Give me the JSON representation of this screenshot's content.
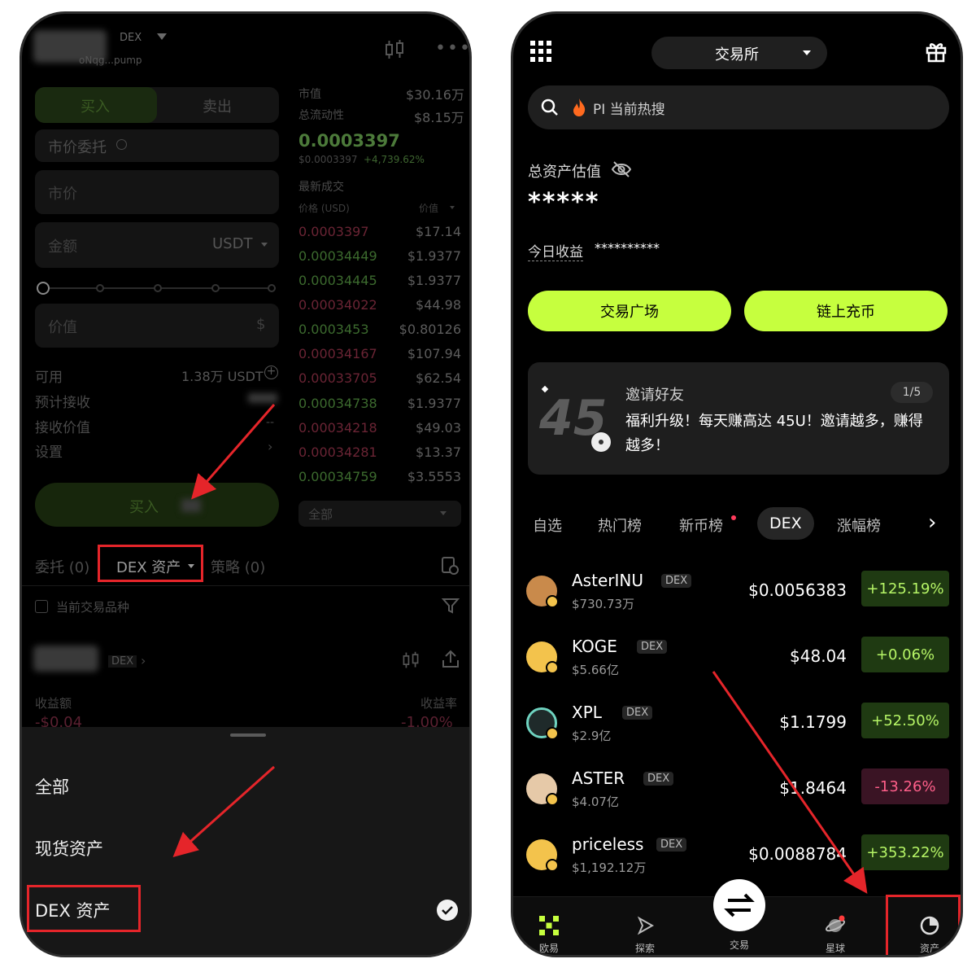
{
  "left": {
    "header": {
      "dex_tag": "DEX",
      "address": "oNqg...pump"
    },
    "trade_tabs": {
      "buy": "买入",
      "sell": "卖出"
    },
    "order_type": "市价委托",
    "market_input": "市价",
    "amount": {
      "label": "金额",
      "unit": "USDT"
    },
    "value_field": {
      "label": "价值",
      "unit": "$"
    },
    "available": {
      "label": "可用",
      "value": "1.38万 USDT"
    },
    "info_rows": [
      "预计接收",
      "接收价值",
      "设置"
    ],
    "receive_value_placeholder": "--",
    "buy_button": "买入",
    "stats": {
      "mcap_label": "市值",
      "mcap": "$30.16万",
      "liq_label": "总流动性",
      "liq": "$8.15万"
    },
    "price": "0.0003397",
    "price_sub": "$0.0003397",
    "price_change": "+4,739.62%",
    "recent_trades": "最新成交",
    "ob_headers": {
      "price": "价格 (USD)",
      "value": "价值"
    },
    "orderbook": [
      {
        "p": "0.0003397",
        "v": "$17.14",
        "side": "sell"
      },
      {
        "p": "0.00034449",
        "v": "$1.9377",
        "side": "buy"
      },
      {
        "p": "0.00034445",
        "v": "$1.9377",
        "side": "buy"
      },
      {
        "p": "0.00034022",
        "v": "$44.98",
        "side": "sell"
      },
      {
        "p": "0.0003453",
        "v": "$0.80126",
        "side": "buy"
      },
      {
        "p": "0.00034167",
        "v": "$107.94",
        "side": "sell"
      },
      {
        "p": "0.00033705",
        "v": "$62.54",
        "side": "sell"
      },
      {
        "p": "0.00034738",
        "v": "$1.9377",
        "side": "buy"
      },
      {
        "p": "0.00034218",
        "v": "$49.03",
        "side": "sell"
      },
      {
        "p": "0.00034281",
        "v": "$13.37",
        "side": "sell"
      },
      {
        "p": "0.00034759",
        "v": "$3.5553",
        "side": "buy"
      }
    ],
    "ob_filter": "全部",
    "bottom_tabs": {
      "orders": "委托 (0)",
      "dex_assets": "DEX 资产",
      "strategy": "策略 (0)"
    },
    "current_pair": "当前交易品种",
    "position": {
      "dex_tag": "DEX",
      "pnl_label": "收益额",
      "pnl_rate_label": "收益率",
      "pnl": "-$0.04",
      "pnl_rate": "-1.00%"
    },
    "sheet": {
      "items": [
        "全部",
        "现货资产",
        "DEX 资产"
      ],
      "selected_index": 2
    }
  },
  "right": {
    "exchange_selector": "交易所",
    "search": {
      "placeholder": "PI 当前热搜"
    },
    "total_assets_label": "总资产估值",
    "total_assets_value": "*****",
    "today_pnl_label": "今日收益",
    "today_pnl_value": "**********",
    "buttons": {
      "trade_square": "交易广场",
      "deposit": "链上充币"
    },
    "banner": {
      "number": "45",
      "title": "邀请好友",
      "page": "1/5",
      "text": "福利升级！每天赚高达 45U！邀请越多，赚得越多！"
    },
    "tabs": [
      "自选",
      "热门榜",
      "新币榜",
      "DEX",
      "涨幅榜"
    ],
    "active_tab_index": 3,
    "coins": [
      {
        "name": "AsterINU",
        "tag": "DEX",
        "cap": "$730.73万",
        "price": "$0.0056383",
        "change": "+125.19%",
        "dir": "up",
        "color": "#c98a4b"
      },
      {
        "name": "KOGE",
        "tag": "DEX",
        "cap": "$5.66亿",
        "price": "$48.04",
        "change": "+0.06%",
        "dir": "flat",
        "color": "#f3c34c"
      },
      {
        "name": "XPL",
        "tag": "DEX",
        "cap": "$2.9亿",
        "price": "$1.1799",
        "change": "+52.50%",
        "dir": "up",
        "color": "#6fd3c0"
      },
      {
        "name": "ASTER",
        "tag": "DEX",
        "cap": "$4.07亿",
        "price": "$1.8464",
        "change": "-13.26%",
        "dir": "down",
        "color": "#e6c9a8"
      },
      {
        "name": "priceless",
        "tag": "DEX",
        "cap": "$1,192.12万",
        "price": "$0.0088784",
        "change": "+353.22%",
        "dir": "up",
        "color": "#f3c34c"
      }
    ],
    "nav": [
      "欧易",
      "探索",
      "交易",
      "星球",
      "资产"
    ]
  },
  "colors": {
    "accent": "#c6ff3e",
    "up": "#b6f566",
    "down": "#ff5f8a",
    "annotation": "#e5252a"
  }
}
